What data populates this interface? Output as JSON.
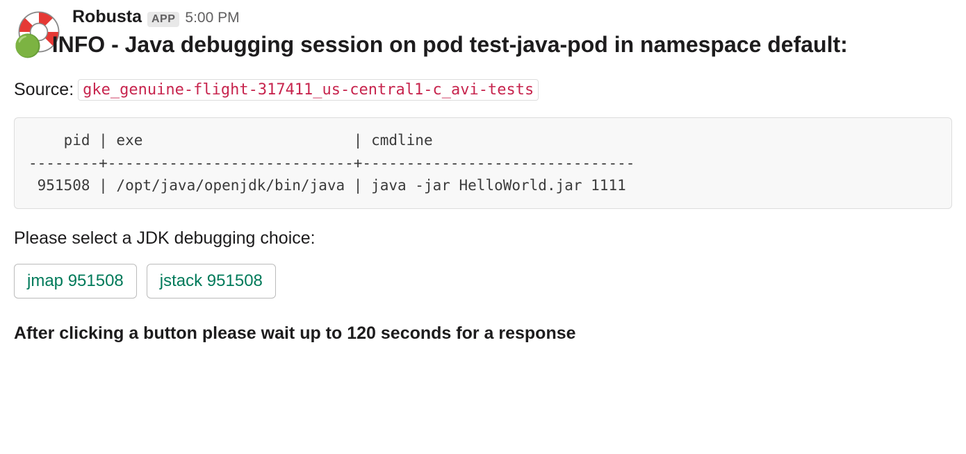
{
  "author": {
    "name": "Robusta",
    "badge": "APP"
  },
  "timestamp": "5:00 PM",
  "message": {
    "status_emoji": "🟢",
    "title": "INFO - Java debugging session on pod test-java-pod in namespace default:",
    "source_label": "Source:",
    "source_value": "gke_genuine-flight-317411_us-central1-c_avi-tests",
    "code_block": "    pid | exe                        | cmdline\n--------+----------------------------+-------------------------------\n 951508 | /opt/java/openjdk/bin/java | java -jar HelloWorld.jar 1111",
    "prompt": "Please select a JDK debugging choice:",
    "footer": "After clicking a button please wait up to 120 seconds for a response"
  },
  "buttons": [
    {
      "label": "jmap 951508"
    },
    {
      "label": "jstack 951508"
    }
  ]
}
